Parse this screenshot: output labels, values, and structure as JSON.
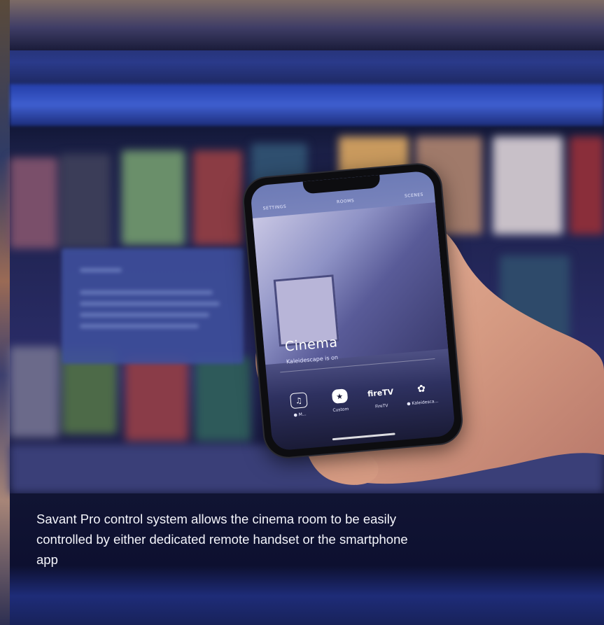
{
  "phone": {
    "nav": {
      "settings": "SETTINGS",
      "rooms": "ROOMS",
      "scenes": "SCENES"
    },
    "room_name": "Cinema",
    "room_status": "Kaleidescape is on",
    "sources": [
      {
        "label": "● M...",
        "icon": "music-note-icon"
      },
      {
        "label": "Custom",
        "icon": "star-icon"
      },
      {
        "label": "FireTV",
        "icon": "firetv-logo-icon",
        "logo_text": "fireTV"
      },
      {
        "label": "● Kaleidesca...",
        "icon": "kaleidescape-logo-icon"
      }
    ]
  },
  "caption": "Savant Pro control system allows the cinema room to be easily controlled by either dedicated remote handset or the smartphone app",
  "colors": {
    "backdrop": "#1a1f45",
    "blue_bar": "#3f5fd0",
    "caption_text": "#f4f5fb",
    "skin": "#d9a189"
  }
}
